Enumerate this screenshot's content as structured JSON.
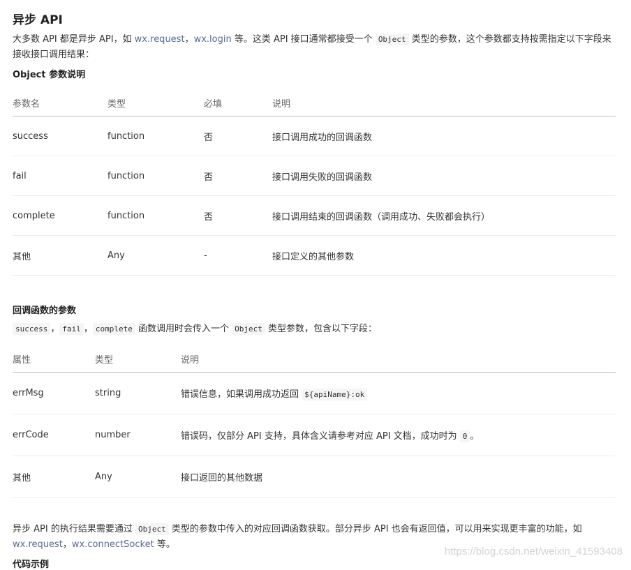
{
  "title": "异步 API",
  "intro": {
    "t1": "大多数 API 都是异步 API，如 ",
    "l1": "wx.request",
    "t2": "，",
    "l2": "wx.login",
    "t3": " 等。这类 API 接口通常都接受一个 ",
    "c1": "Object",
    "t4": " 类型的参数，这个参数都支持按需指定以下字段来接收接口调用结果："
  },
  "object_section_title": "Object 参数说明",
  "table1": {
    "headers": [
      "参数名",
      "类型",
      "必填",
      "说明"
    ],
    "rows": [
      [
        "success",
        "function",
        "否",
        "接口调用成功的回调函数"
      ],
      [
        "fail",
        "function",
        "否",
        "接口调用失败的回调函数"
      ],
      [
        "complete",
        "function",
        "否",
        "接口调用结束的回调函数（调用成功、失败都会执行）"
      ],
      [
        "其他",
        "Any",
        "-",
        "接口定义的其他参数"
      ]
    ]
  },
  "callback_section_title": "回调函数的参数",
  "callback_desc": {
    "c1": "success",
    "s1": "，",
    "c2": "fail",
    "s2": "，",
    "c3": "complete",
    "t1": " 函数调用时会传入一个 ",
    "c4": "Object",
    "t2": " 类型参数，包含以下字段："
  },
  "table2": {
    "headers": [
      "属性",
      "类型",
      "说明"
    ],
    "rows": [
      {
        "name": "errMsg",
        "type": "string",
        "desc": "错误信息，如果调用成功返回 ",
        "code": "${apiName}:ok",
        "tail": ""
      },
      {
        "name": "errCode",
        "type": "number",
        "desc": "错误码，仅部分 API 支持，具体含义请参考对应 API 文档，成功时为 ",
        "code": "0",
        "tail": "。"
      },
      {
        "name": "其他",
        "type": "Any",
        "desc": "接口返回的其他数据",
        "code": "",
        "tail": ""
      }
    ]
  },
  "outro": {
    "t1": "异步 API 的执行结果需要通过 ",
    "c1": "Object",
    "t2": " 类型的参数中传入的对应回调函数获取。部分异步 API 也会有返回值，可以用来实现更丰富的功能，如 ",
    "l1": "wx.request",
    "t3": "，",
    "l2": "wx.connectSocket",
    "t4": " 等。"
  },
  "next_heading": "代码示例",
  "watermark": "https://blog.csdn.net/weixin_41593408",
  "colors": {
    "link": "#576b95",
    "text": "#333333",
    "code_bg": "#f5f5f5"
  }
}
